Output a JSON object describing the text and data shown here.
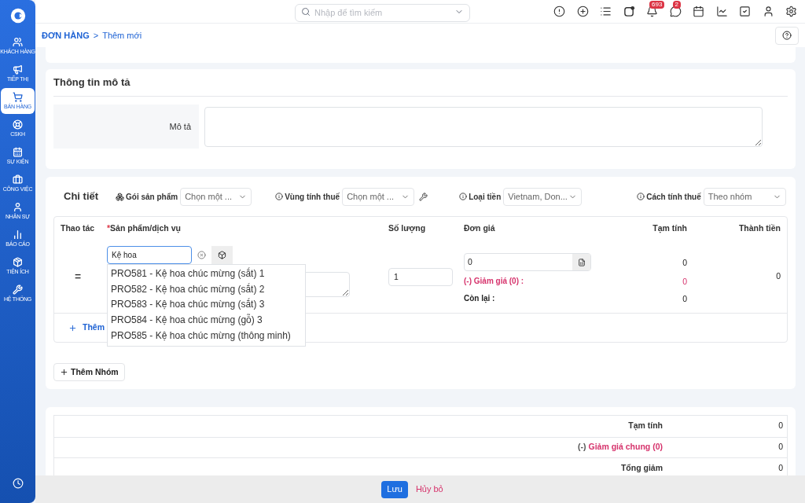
{
  "sidebar": {
    "items": [
      {
        "label": "KHÁCH HÀNG",
        "selected": false
      },
      {
        "label": "TIẾP THỊ",
        "selected": false
      },
      {
        "label": "BÁN HÀNG",
        "selected": true
      },
      {
        "label": "CSKH",
        "selected": false
      },
      {
        "label": "SỰ KIỆN",
        "selected": false
      },
      {
        "label": "CÔNG VIỆC",
        "selected": false
      },
      {
        "label": "NHÂN SỰ",
        "selected": false
      },
      {
        "label": "BÁO CÁO",
        "selected": false
      },
      {
        "label": "TIỆN ÍCH",
        "selected": false
      },
      {
        "label": "HỆ THỐNG",
        "selected": false
      }
    ]
  },
  "topbar": {
    "search": {
      "placeholder": "Nhập để tìm kiếm"
    },
    "notifications_badge": "693",
    "messages_badge": "2"
  },
  "breadcrumb": {
    "section": "ĐƠN HÀNG",
    "separator": ">",
    "page": "Thêm mới"
  },
  "description": {
    "title": "Thông tin mô tả",
    "label": "Mô tả"
  },
  "details": {
    "title": "Chi tiết",
    "filters": [
      {
        "label": "Gói sản phẩm",
        "value": "Chọn một ...",
        "kind": "package"
      },
      {
        "label": "Vùng tính thuế",
        "value": "Chọn một ...",
        "kind": "info-tool"
      },
      {
        "label": "Loại tiền",
        "value": "Vietnam, Don...",
        "kind": "info"
      },
      {
        "label": "Cách tính thuế",
        "value": "Theo nhóm",
        "kind": "info"
      }
    ],
    "required_mark": "*",
    "columns": [
      "Thao tác",
      "Sản phẩm/dịch vụ",
      "Số lượng",
      "Đơn giá",
      "Tạm tính",
      "Thành tiền"
    ],
    "row": {
      "drag_handle": "=",
      "product_value": "Kệ hoa",
      "quantity": "1",
      "unit_price": "0",
      "discount_label": "(-) Giảm giá (0) :",
      "remaining_label": "Còn lại :",
      "subtotal": "0",
      "discount": "0",
      "remaining": "0",
      "total": "0"
    },
    "suggestions": [
      "PRO581 - Kệ hoa chúc mừng (sắt) 1",
      "PRO582 - Kệ hoa chúc mừng (sắt) 2",
      "PRO583 - Kệ hoa chúc mừng (sắt) 3",
      "PRO584 - Kệ hoa chúc mừng (gỗ) 3",
      "PRO585 - Kệ hoa chúc mừng (thông minh)"
    ],
    "add_row": "Thêm",
    "add_group": "Thêm Nhóm"
  },
  "summary": [
    {
      "label": "Tạm tính",
      "value": "0",
      "kind": "plain"
    },
    {
      "prefix": "(-)",
      "label": "Giảm giá chung (0)",
      "value": "0",
      "kind": "discount"
    },
    {
      "label": "Tổng giảm",
      "value": "0",
      "kind": "plain"
    }
  ],
  "footer": {
    "save": "Lưu",
    "cancel": "Hủy bỏ"
  }
}
